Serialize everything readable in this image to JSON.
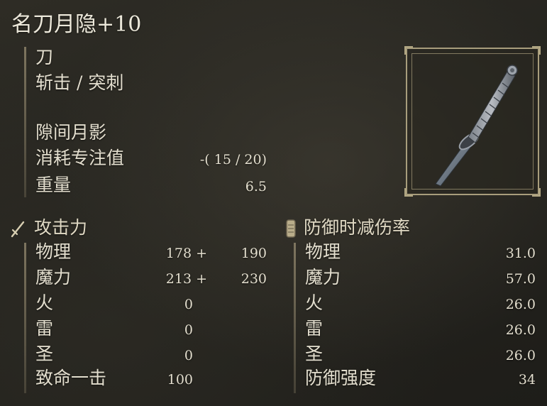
{
  "weapon": {
    "name": "名刀月隐+10",
    "type": "刀",
    "attack_type": "斩击 / 突刺",
    "skill": "隙间月影",
    "fp_cost_label": "消耗专注值",
    "fp_cost_value": "-(  15 / 20)",
    "weight_label": "重量",
    "weight_value": "6.5"
  },
  "attack": {
    "title": "攻击力",
    "rows": [
      {
        "label": "物理",
        "base": "178 +",
        "extra": "190"
      },
      {
        "label": "魔力",
        "base": "213 +",
        "extra": "230"
      },
      {
        "label": "火",
        "base": "0",
        "extra": ""
      },
      {
        "label": "雷",
        "base": "0",
        "extra": ""
      },
      {
        "label": "圣",
        "base": "0",
        "extra": ""
      },
      {
        "label": "致命一击",
        "base": "100",
        "extra": ""
      }
    ]
  },
  "defense": {
    "title": "防御时减伤率",
    "rows": [
      {
        "label": "物理",
        "value": "31.0"
      },
      {
        "label": "魔力",
        "value": "57.0"
      },
      {
        "label": "火",
        "value": "26.0"
      },
      {
        "label": "雷",
        "value": "26.0"
      },
      {
        "label": "圣",
        "value": "26.0"
      },
      {
        "label": "防御强度",
        "value": "34"
      }
    ]
  },
  "icons": {
    "attack": "sword-icon",
    "defense": "shield-icon",
    "weapon_image": "katana-image"
  }
}
